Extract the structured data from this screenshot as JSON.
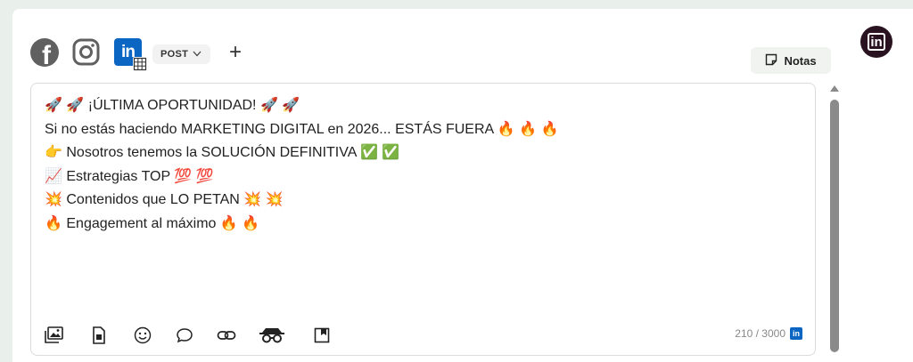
{
  "networks": {
    "facebook_icon": "facebook-icon",
    "instagram_icon": "instagram-icon",
    "linkedin_icon": "linkedin-icon",
    "linkedin_logo_text": "in",
    "post_type": "POST",
    "add_label": "+"
  },
  "notes": {
    "label": "Notas"
  },
  "avatar": {
    "logo_text": "in"
  },
  "editor": {
    "lines": [
      "🚀 🚀 ¡ÚLTIMA OPORTUNIDAD! 🚀 🚀",
      "Si no estás haciendo MARKETING DIGITAL en 2026... ESTÁS FUERA 🔥 🔥 🔥",
      "👉 Nosotros tenemos la SOLUCIÓN DEFINITIVA ✅ ✅",
      "📈 Estrategias TOP 💯 💯",
      "💥 Contenidos que LO PETAN 💥 💥",
      "🔥 Engagement al máximo 🔥 🔥"
    ],
    "counter": "210 / 3000",
    "counter_network_text": "in"
  },
  "toolbar": {
    "icons": [
      "image-gallery-icon",
      "document-icon",
      "emoji-icon",
      "comment-icon",
      "link-icon",
      "spy-glasses-icon",
      "bookmark-icon"
    ]
  },
  "colors": {
    "linkedin": "#0a66c2",
    "avatar_bg": "#2a1320",
    "page_bg": "#e9efea"
  }
}
